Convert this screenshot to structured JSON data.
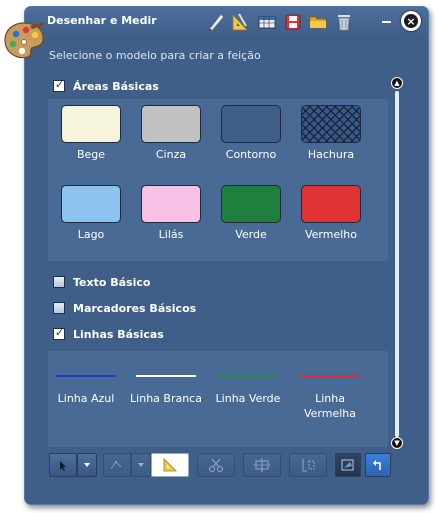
{
  "window": {
    "title": "Desenhar e Medir",
    "close_label": "×"
  },
  "instruction": "Selecione o modelo para criar a feição",
  "groups": {
    "areas": {
      "label": "Áreas Básicas",
      "checked": true
    },
    "texto": {
      "label": "Texto Básico",
      "checked": false
    },
    "marcadores": {
      "label": "Marcadores Básicos",
      "checked": false
    },
    "linhas": {
      "label": "Linhas Básicas",
      "checked": true
    }
  },
  "area_templates": [
    {
      "label": "Bege",
      "color": "#f7f4dc"
    },
    {
      "label": "Cinza",
      "color": "#c2c2c2"
    },
    {
      "label": "Contorno",
      "color": "#3f5f89"
    },
    {
      "label": "Hachura",
      "color": "#3a5785"
    },
    {
      "label": "Lago",
      "color": "#8ec3ef"
    },
    {
      "label": "Lilás",
      "color": "#f8c0e4"
    },
    {
      "label": "Verde",
      "color": "#1f7f3e"
    },
    {
      "label": "Vermelho",
      "color": "#e03434"
    }
  ],
  "line_templates": [
    {
      "label": "Linha Azul",
      "color": "#1e3fc0"
    },
    {
      "label": "Linha Branca",
      "color": "#ffffff"
    },
    {
      "label": "Linha Verde",
      "color": "#1f8a3a"
    },
    {
      "label": "Linha Vermelha",
      "color": "#d03030"
    }
  ],
  "toolbar_icons": [
    "pencil-icon",
    "measure-icon",
    "table-icon",
    "save-icon",
    "folder-icon",
    "trash-icon"
  ],
  "bottom_tools": [
    "select-icon",
    "dropdown-icon",
    "vertex-icon",
    "dropdown-icon",
    "measure-icon",
    "cut-icon",
    "split-icon",
    "union-icon",
    "reshape-icon",
    "undo-icon"
  ]
}
